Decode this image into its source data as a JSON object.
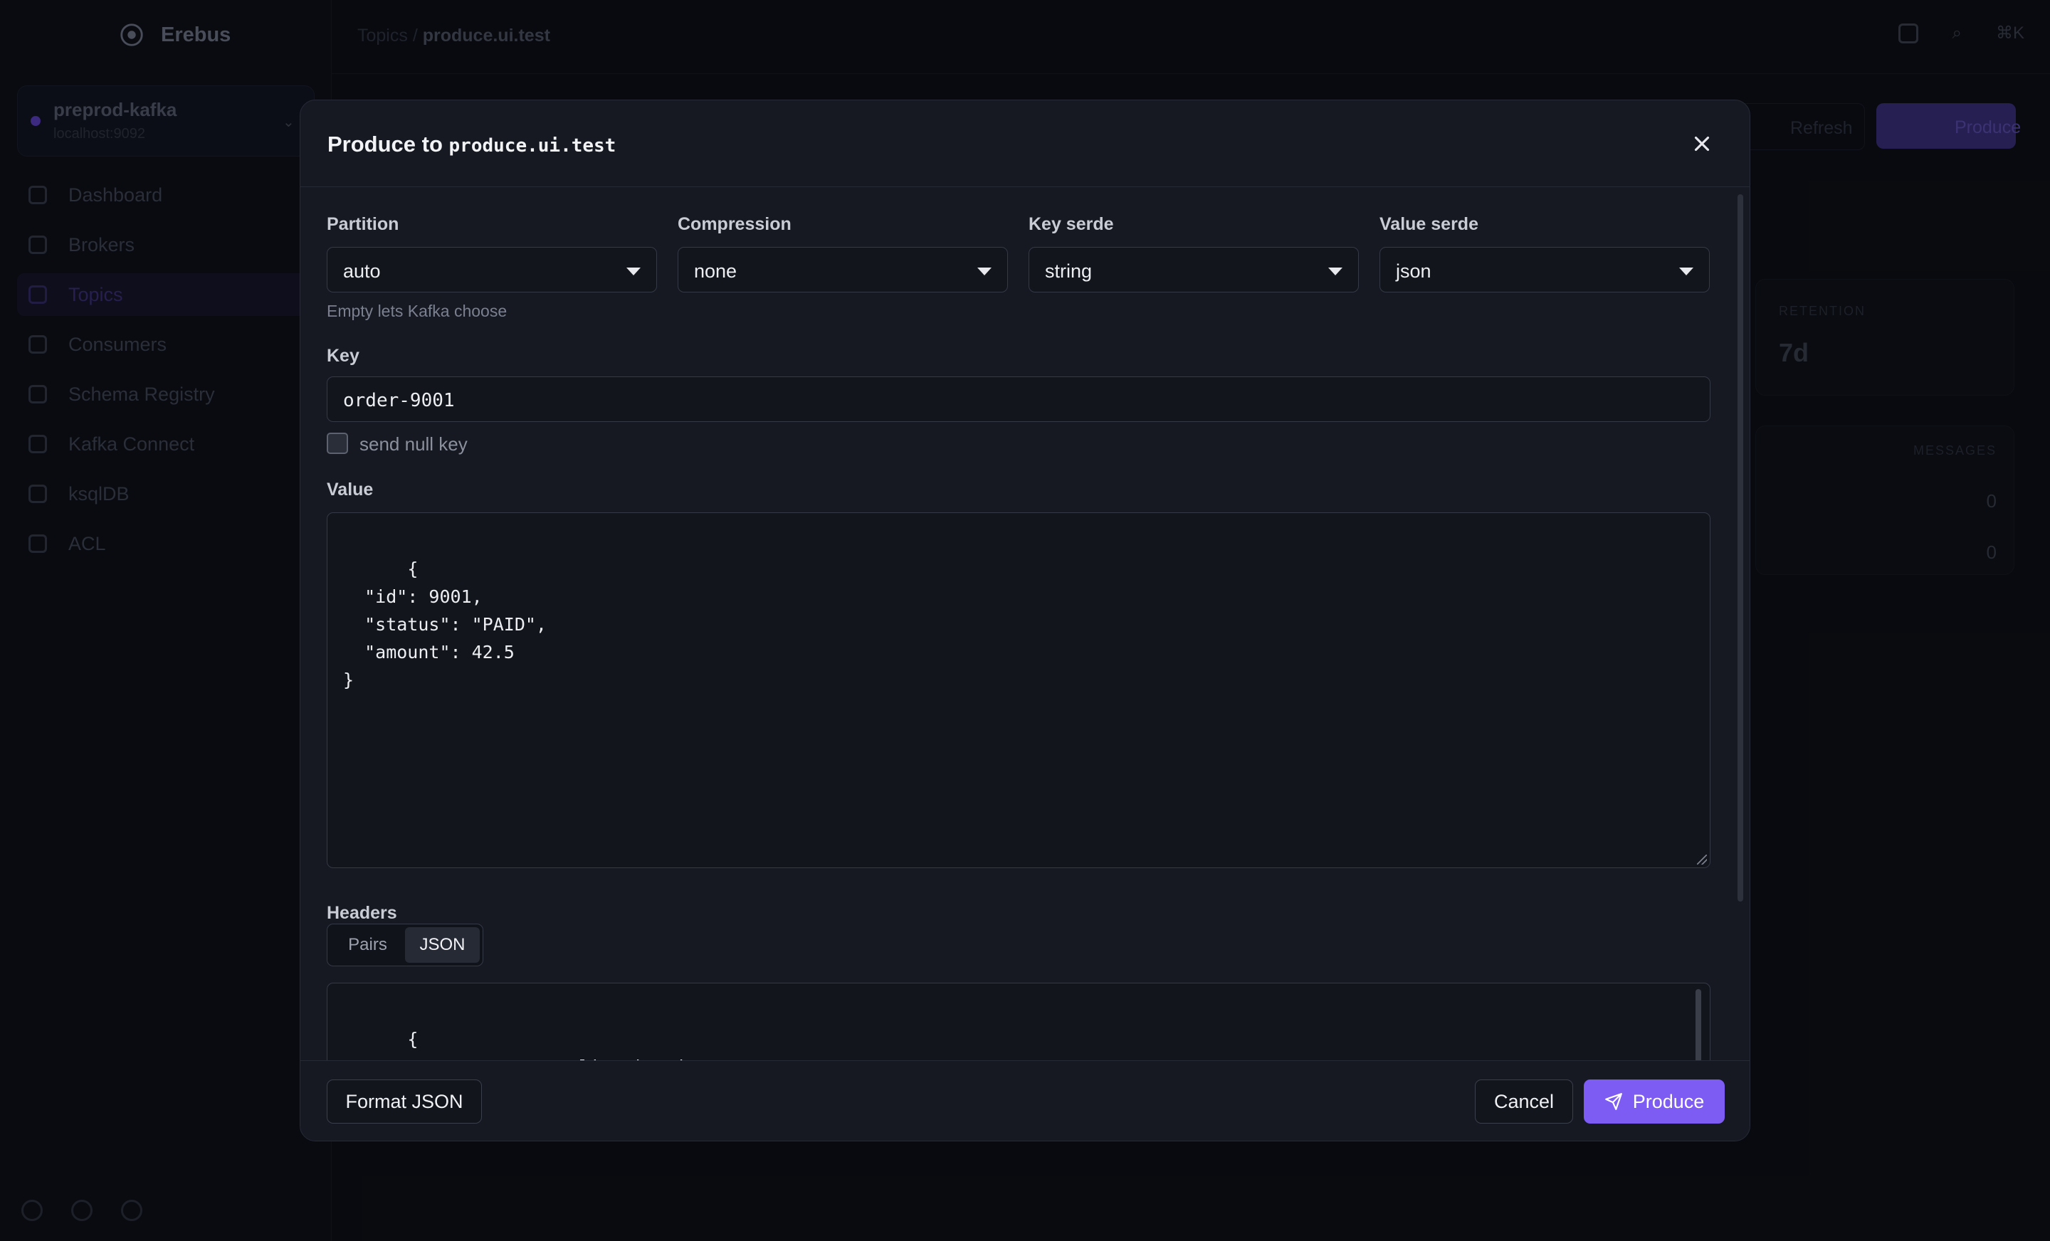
{
  "app": {
    "brand": "Erebus",
    "cluster": {
      "name": "preprod-kafka",
      "host": "localhost:9092"
    },
    "nav": [
      {
        "label": "Dashboard",
        "active": false
      },
      {
        "label": "Brokers",
        "active": false
      },
      {
        "label": "Topics",
        "active": true
      },
      {
        "label": "Consumers",
        "active": false
      },
      {
        "label": "Schema Registry",
        "active": false
      },
      {
        "label": "Kafka Connect",
        "active": false
      },
      {
        "label": "ksqlDB",
        "active": false
      },
      {
        "label": "ACL",
        "active": false
      }
    ],
    "breadcrumb": {
      "parent": "Topics",
      "separator": "/",
      "current": "produce.ui.test"
    },
    "search_shortcut": "⌘K",
    "refresh_label": "Refresh",
    "produce_label": "Produce",
    "retention_label": "RETENTION",
    "retention_value": "7d",
    "messages_header": "MESSAGES",
    "message_counts": [
      "0",
      "0"
    ]
  },
  "modal": {
    "title_prefix": "Produce to",
    "topic": "produce.ui.test",
    "fields": {
      "partition": {
        "label": "Partition",
        "value": "auto",
        "hint": "Empty lets Kafka choose"
      },
      "compression": {
        "label": "Compression",
        "value": "none"
      },
      "key_serde": {
        "label": "Key serde",
        "value": "string"
      },
      "value_serde": {
        "label": "Value serde",
        "value": "json"
      },
      "key": {
        "label": "Key",
        "value": "order-9001"
      },
      "null_key": {
        "label": "send null key",
        "checked": false
      },
      "value": {
        "label": "Value",
        "text": "{\n  \"id\": 9001,\n  \"status\": \"PAID\",\n  \"amount\": 42.5\n}"
      },
      "headers": {
        "label": "Headers",
        "modes": [
          "Pairs",
          "JSON"
        ],
        "active_mode": "JSON",
        "text": "{\n  \"content-type\": \"application/json\",\n  \"x-request-id\": \"..."
      }
    },
    "footer": {
      "format_label": "Format JSON",
      "cancel_label": "Cancel",
      "produce_label": "Produce"
    },
    "colors": {
      "accent": "#7c5cf2",
      "surface": "#161922",
      "backdrop": "#0c0e13"
    }
  }
}
